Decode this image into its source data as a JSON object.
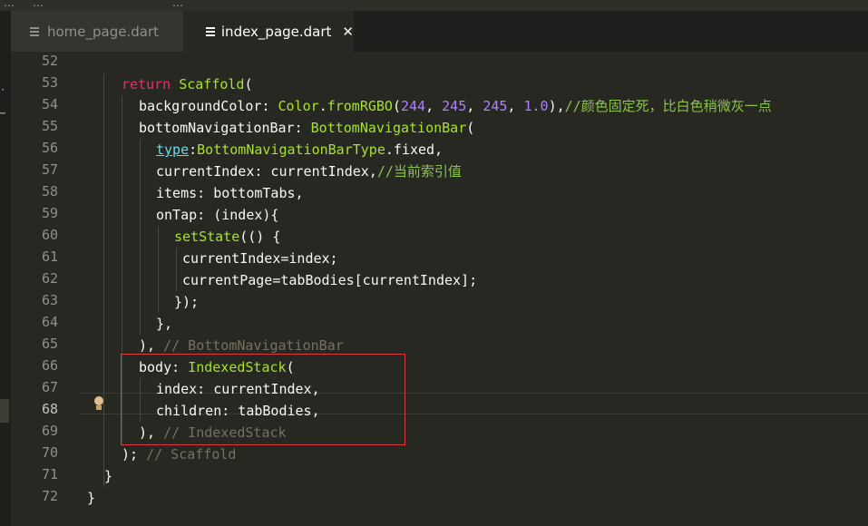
{
  "window": {
    "title_fragments": [
      "…",
      "…",
      "…"
    ]
  },
  "tabs": [
    {
      "label": "home_page.dart",
      "active": false
    },
    {
      "label": "index_page.dart",
      "active": true,
      "close_glyph": "✕"
    }
  ],
  "editor": {
    "current_line": 68,
    "line_numbers": [
      "52",
      "53",
      "54",
      "55",
      "56",
      "57",
      "58",
      "59",
      "60",
      "61",
      "62",
      "63",
      "64",
      "65",
      "66",
      "67",
      "68",
      "69",
      "70",
      "71",
      "72"
    ],
    "lines": {
      "l53": {
        "kw": "return",
        "cls": "Scaffold",
        "rest": "("
      },
      "l54": {
        "a": "backgroundColor: ",
        "cls": "Color",
        "b": ".",
        "fn": "fromRGBO",
        "c": "(",
        "n1": "244",
        "d": ", ",
        "n2": "245",
        "e": ", ",
        "n3": "245",
        "f": ", ",
        "n4": "1.0",
        "g": "),",
        "cmt": "//颜色固定死，比白色稍微灰一点"
      },
      "l55": {
        "a": "bottomNavigationBar: ",
        "cls": "BottomNavigationBar",
        "b": "("
      },
      "l56": {
        "typ": "type",
        "a": ":",
        "cls": "BottomNavigationBarType",
        "b": ".fixed,"
      },
      "l57": {
        "a": "currentIndex: currentIndex,",
        "cmt": "//当前索引值"
      },
      "l58": {
        "a": "items: bottomTabs,"
      },
      "l59": {
        "a": "onTap: (index){"
      },
      "l60": {
        "fn": "setState",
        "a": "(() {"
      },
      "l61": {
        "a": "currentIndex=index;"
      },
      "l62": {
        "a": "currentPage=tabBodies[currentIndex];"
      },
      "l63": {
        "a": "});"
      },
      "l64": {
        "a": "},"
      },
      "l65": {
        "a": "), ",
        "cmt": "// BottomNavigationBar"
      },
      "l66": {
        "a": "body: ",
        "cls": "IndexedStack",
        "b": "("
      },
      "l67": {
        "a": "index: currentIndex,"
      },
      "l68": {
        "a": "children: tabBodies,"
      },
      "l69": {
        "a": "), ",
        "cmt": "// IndexedStack"
      },
      "l70": {
        "a": "); ",
        "cmt": "// Scaffold"
      },
      "l71": {
        "a": "}"
      },
      "l72": {
        "a": "}"
      }
    }
  },
  "colors": {
    "background": "#272822",
    "keyword": "#f92672",
    "class": "#a6e22e",
    "number": "#ae81ff",
    "comment": "#75715e",
    "highlight_box": "#e0393e"
  },
  "icons": {
    "tab_file_icon": "file-lines-icon",
    "lightbulb": "lightbulb-icon"
  }
}
